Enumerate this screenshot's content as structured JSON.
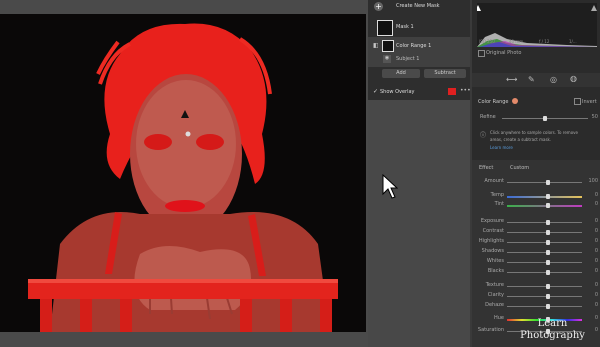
{
  "masks_panel": {
    "create_new_mask": "Create New Mask",
    "mask1_label": "Mask 1",
    "color_range_label": "Color Range 1",
    "subject_label": "Subject 1",
    "add_label": "Add",
    "subtract_label": "Subtract",
    "show_overlay_label": "Show Overlay",
    "overlay_color": "#e02020"
  },
  "histogram": {
    "iso": "ISO 250",
    "focal": "40 mm",
    "aperture": "f / 12",
    "shutter": "1/...",
    "original_photo_label": "Original Photo"
  },
  "color_range": {
    "label": "Color Range",
    "invert_label": "Invert",
    "refine_label": "Refine",
    "refine_value": "50",
    "hint_line1": "Click anywhere to sample colors. To remove",
    "hint_line2": "areas, create a subtract mask.",
    "learn_more": "Learn more"
  },
  "effect": {
    "effect_label": "Effect",
    "preset_value": "Custom",
    "sliders": [
      {
        "label": "Amount",
        "value": "100",
        "pos": 0.55
      },
      {
        "label": "Temp",
        "value": "0",
        "pos": 0.55
      },
      {
        "label": "Tint",
        "value": "0",
        "pos": 0.55
      },
      {
        "label": "Exposure",
        "value": "0",
        "pos": 0.55
      },
      {
        "label": "Contrast",
        "value": "0",
        "pos": 0.55
      },
      {
        "label": "Highlights",
        "value": "0",
        "pos": 0.55
      },
      {
        "label": "Shadows",
        "value": "0",
        "pos": 0.55
      },
      {
        "label": "Whites",
        "value": "0",
        "pos": 0.55
      },
      {
        "label": "Blacks",
        "value": "0",
        "pos": 0.55
      },
      {
        "label": "Texture",
        "value": "0",
        "pos": 0.55
      },
      {
        "label": "Clarity",
        "value": "0",
        "pos": 0.55
      },
      {
        "label": "Dehaze",
        "value": "0",
        "pos": 0.55
      },
      {
        "label": "Hue",
        "value": "0",
        "pos": 0.55
      },
      {
        "label": "Saturation",
        "value": "0",
        "pos": 0.55
      }
    ]
  },
  "watermark": {
    "line1": "Learn",
    "line2": "Photography"
  }
}
